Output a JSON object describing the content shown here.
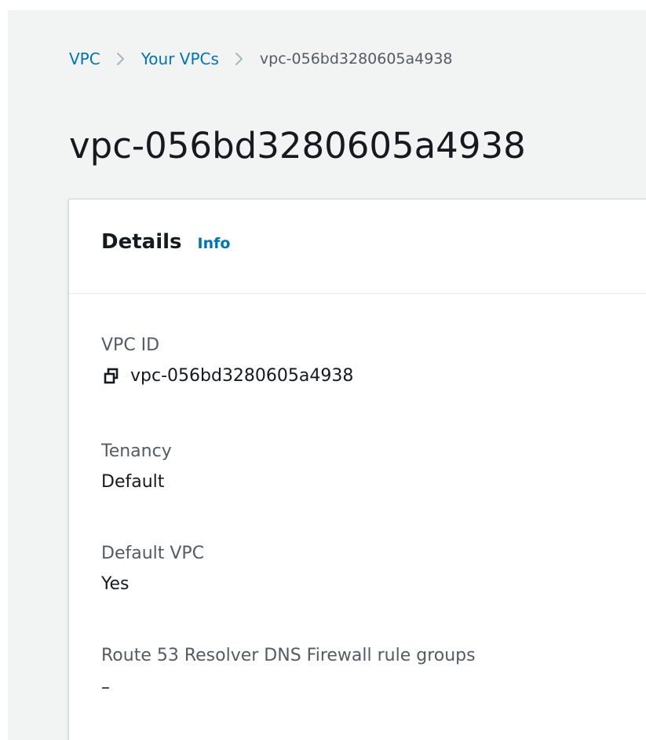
{
  "breadcrumb": {
    "items": [
      "VPC",
      "Your VPCs"
    ],
    "current": "vpc-056bd3280605a4938"
  },
  "page": {
    "title": "vpc-056bd3280605a4938"
  },
  "details": {
    "title": "Details",
    "info_label": "Info",
    "vpc_id": {
      "label": "VPC ID",
      "value": "vpc-056bd3280605a4938",
      "icon": "copy-icon"
    },
    "tenancy": {
      "label": "Tenancy",
      "value": "Default"
    },
    "default_vpc": {
      "label": "Default VPC",
      "value": "Yes"
    },
    "route53": {
      "label": "Route 53 Resolver DNS Firewall rule groups",
      "value": "–"
    }
  },
  "colors": {
    "link": "#0073bb",
    "page_background": "#f2f3f3",
    "text": "#16191f",
    "secondary_text": "#545b64"
  }
}
